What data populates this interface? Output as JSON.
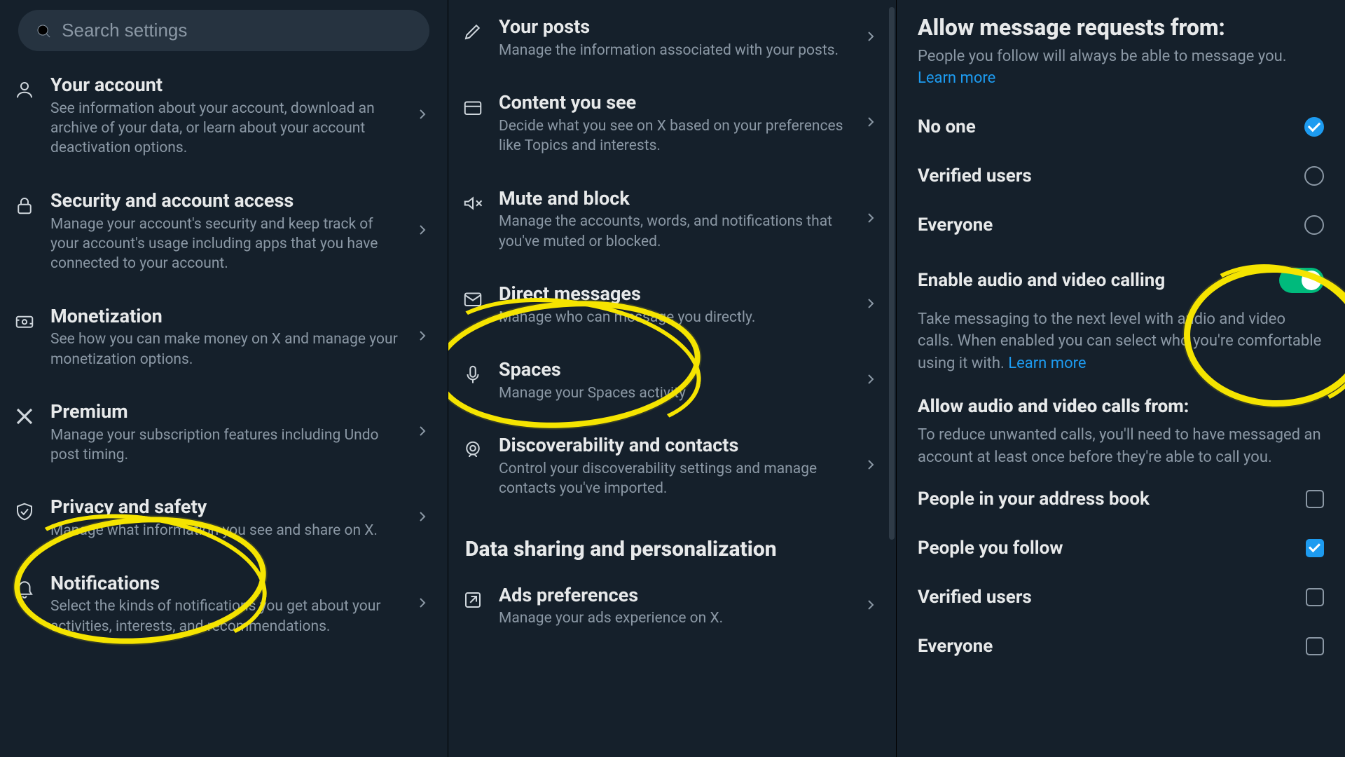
{
  "search": {
    "placeholder": "Search settings"
  },
  "left": {
    "items": [
      {
        "title": "Your account",
        "desc": "See information about your account, download an archive of your data, or learn about your account deactivation options.",
        "icon": "user"
      },
      {
        "title": "Security and account access",
        "desc": "Manage your account's security and keep track of your account's usage including apps that you have connected to your account.",
        "icon": "lock"
      },
      {
        "title": "Monetization",
        "desc": "See how you can make money on X and manage your monetization options.",
        "icon": "money"
      },
      {
        "title": "Premium",
        "desc": "Manage your subscription features including Undo post timing.",
        "icon": "x-logo"
      },
      {
        "title": "Privacy and safety",
        "desc": "Manage what information you see and share on X.",
        "icon": "shield"
      },
      {
        "title": "Notifications",
        "desc": "Select the kinds of notifications you get about your activities, interests, and recommendations.",
        "icon": "bell"
      }
    ]
  },
  "mid": {
    "items": [
      {
        "title": "Your posts",
        "desc": "Manage the information associated with your posts.",
        "icon": "pencil"
      },
      {
        "title": "Content you see",
        "desc": "Decide what you see on X based on your preferences like Topics and interests.",
        "icon": "card"
      },
      {
        "title": "Mute and block",
        "desc": "Manage the accounts, words, and notifications that you've muted or blocked.",
        "icon": "mute"
      },
      {
        "title": "Direct messages",
        "desc": "Manage who can message you directly.",
        "icon": "mail"
      },
      {
        "title": "Spaces",
        "desc": "Manage your Spaces activity",
        "icon": "mic"
      },
      {
        "title": "Discoverability and contacts",
        "desc": "Control your discoverability settings and manage contacts you've imported.",
        "icon": "contacts"
      }
    ],
    "section": "Data sharing and personalization",
    "ads": {
      "title": "Ads preferences",
      "desc": "Manage your ads experience on X.",
      "icon": "external"
    }
  },
  "right": {
    "header": "Allow message requests from:",
    "sub": "People you follow will always be able to message you. ",
    "learn": "Learn more",
    "radios": [
      {
        "label": "No one",
        "checked": true
      },
      {
        "label": "Verified users",
        "checked": false
      },
      {
        "label": "Everyone",
        "checked": false
      }
    ],
    "toggle_label": "Enable audio and video calling",
    "toggle_desc": "Take messaging to the next level with audio and video calls. When enabled you can select who you're comfortable using it with. ",
    "calls_header": "Allow audio and video calls from:",
    "calls_sub": "To reduce unwanted calls, you'll need to have messaged an account at least once before they're able to call you.",
    "checks": [
      {
        "label": "People in your address book",
        "checked": false
      },
      {
        "label": "People you follow",
        "checked": true
      },
      {
        "label": "Verified users",
        "checked": false
      },
      {
        "label": "Everyone",
        "checked": false
      }
    ]
  }
}
